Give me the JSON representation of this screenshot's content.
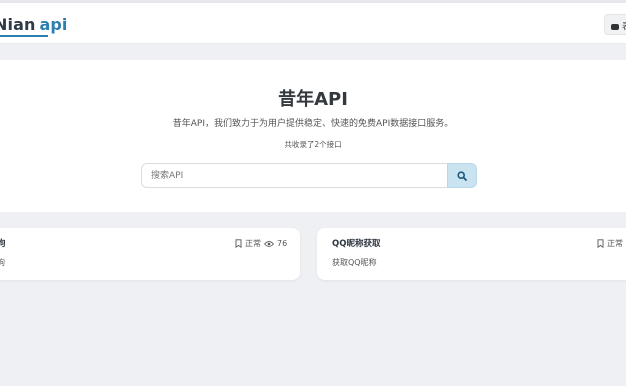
{
  "header": {
    "logo_word1": "Nian",
    "logo_word2": "api",
    "right_button_label": "表"
  },
  "hero": {
    "title": "昔年API",
    "description": "昔年API，我们致力于为用户提供稳定、快速的免费API数据接口服务。",
    "count_text": "共收录了2个接口"
  },
  "search": {
    "placeholder": "搜索API",
    "button_icon": "search-icon"
  },
  "cards": [
    {
      "title": "狗",
      "subtitle": "狗",
      "status": "正常",
      "views": "76",
      "status_icon": "bookmark-icon",
      "views_icon": "eye-icon"
    },
    {
      "title": "QQ昵称获取",
      "subtitle": "获取QQ昵称",
      "status": "正常",
      "status_icon": "bookmark-icon"
    }
  ],
  "colors": {
    "brand": "#2c7fb0",
    "page_bg": "#eef0f3",
    "search_button_bg": "#c9e3f1"
  }
}
